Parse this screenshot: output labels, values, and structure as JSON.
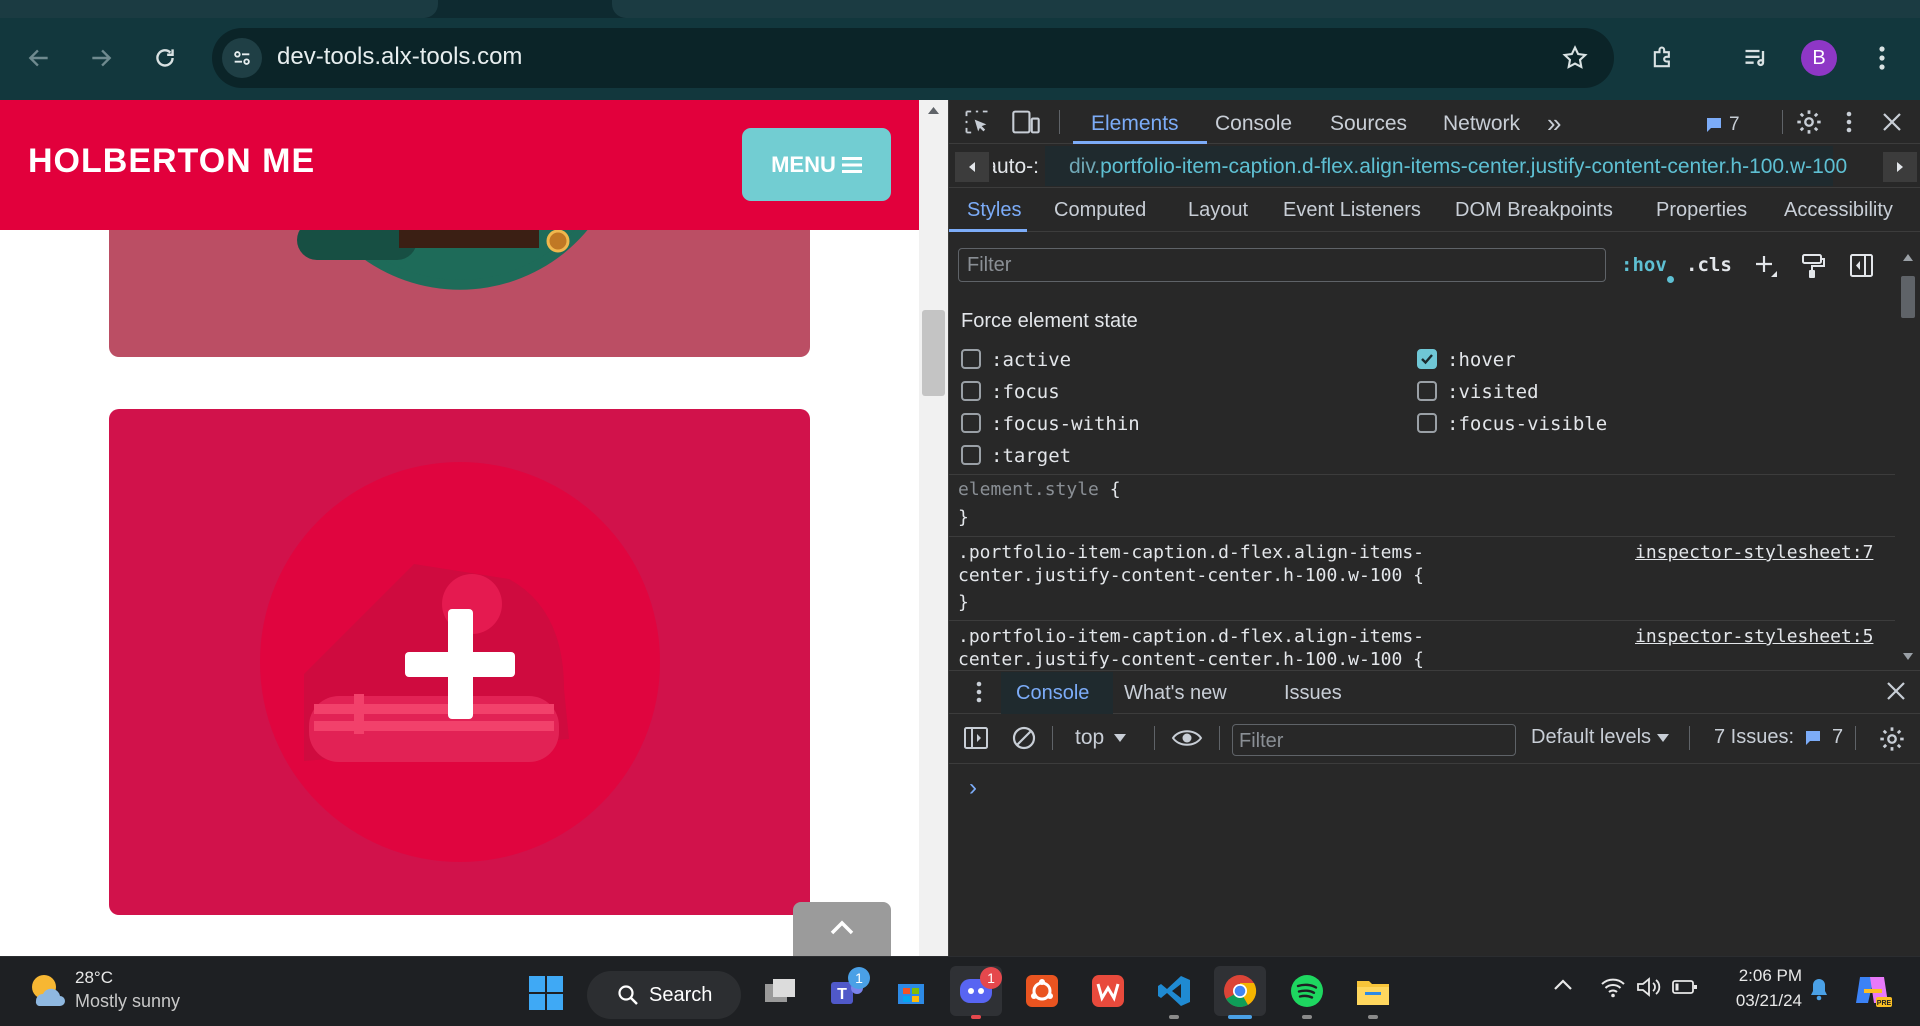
{
  "browser": {
    "url": "dev-tools.alx-tools.com",
    "profile_initial": "B",
    "profile_color": "#8e37c6"
  },
  "site": {
    "brand": "HOLBERTON ME",
    "menu_label": "MENU",
    "brand_color": "#e2003c",
    "menu_color": "#72cdd2"
  },
  "devtools": {
    "tabs": [
      "Elements",
      "Console",
      "Sources",
      "Network"
    ],
    "active_tab": "Elements",
    "more_tabs": "»",
    "issues_count": "7",
    "breadcrumb_prev": ":-auto",
    "breadcrumb_tag": "div",
    "breadcrumb_class": ".portfolio-item-caption.d-flex.align-items-center.justify-content-center.h-100.w-100",
    "styles_tabs": [
      "Styles",
      "Computed",
      "Layout",
      "Event Listeners",
      "DOM Breakpoints",
      "Properties",
      "Accessibility"
    ],
    "filter_placeholder": "Filter",
    "hov_label": ":hov",
    "cls_label": ".cls",
    "force_state_title": "Force element state",
    "states": [
      {
        "label": ":active",
        "checked": false
      },
      {
        "label": ":hover",
        "checked": true
      },
      {
        "label": ":focus",
        "checked": false
      },
      {
        "label": ":visited",
        "checked": false
      },
      {
        "label": ":focus-within",
        "checked": false
      },
      {
        "label": ":focus-visible",
        "checked": false
      },
      {
        "label": ":target",
        "checked": false
      }
    ],
    "element_style": "element.style",
    "open_brace": "{",
    "close_brace": "}",
    "rule1_sel_a": ".portfolio-item-caption.d-flex.align-items-",
    "rule1_sel_b": "center.justify-content-center.h-100.w-100 {",
    "rule1_src": "inspector-stylesheet:7",
    "rule2_sel_a": ".portfolio-item-caption.d-flex.align-items-",
    "rule2_sel_b": "center.justify-content-center.h-100.w-100 {",
    "rule2_src": "inspector-stylesheet:5",
    "drawer_tabs": [
      "Console",
      "What's new",
      "Issues"
    ],
    "context": "top",
    "console_filter_placeholder": "Filter",
    "levels": "Default levels",
    "issues_label": "7 Issues:",
    "issues_num": "7",
    "prompt": "›"
  },
  "taskbar": {
    "temp": "28°C",
    "weather": "Mostly sunny",
    "search": "Search",
    "teams_badge": "1",
    "discord_badge": "1",
    "time": "2:06 PM",
    "date": "03/21/24"
  }
}
